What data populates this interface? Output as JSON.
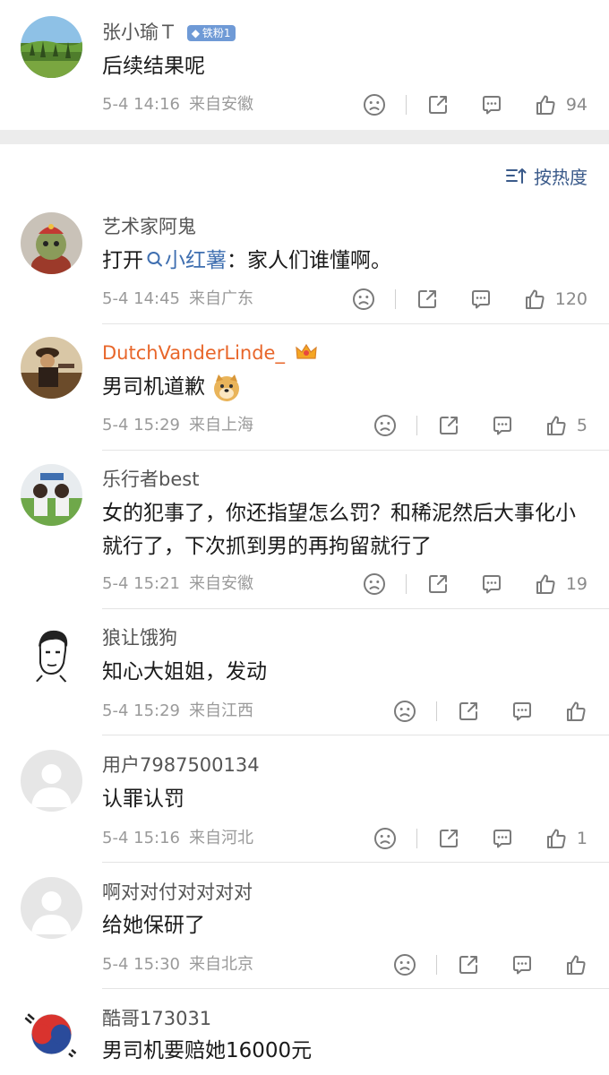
{
  "post": {
    "username": "张小瑜Ｔ",
    "badge": "铁粉1",
    "text": "后续结果呢",
    "date": "5-4 14:16",
    "location": "来自安徽",
    "likes": "94"
  },
  "sort": {
    "label": "按热度"
  },
  "comments": [
    {
      "username": "艺术家阿鬼",
      "text_prefix": "打开",
      "link_text": "小红薯",
      "text_suffix": "：家人们谁懂啊。",
      "date": "5-4 14:45",
      "location": "来自广东",
      "likes": "120"
    },
    {
      "username": "DutchVanderLinde_",
      "text": "男司机道歉",
      "date": "5-4 15:29",
      "location": "来自上海",
      "likes": "5"
    },
    {
      "username": "乐行者best",
      "text": "女的犯事了，你还指望怎么罚？和稀泥然后大事化小就行了，下次抓到男的再拘留就行了",
      "date": "5-4 15:21",
      "location": "来自安徽",
      "likes": "19"
    },
    {
      "username": "狼让饿狗",
      "text": "知心大姐姐，发动",
      "date": "5-4 15:29",
      "location": "来自江西",
      "likes": ""
    },
    {
      "username": "用户7987500134",
      "text": "认罪认罚",
      "date": "5-4 15:16",
      "location": "来自河北",
      "likes": "1"
    },
    {
      "username": "啊对对付对对对对",
      "text": "给她保研了",
      "date": "5-4 15:30",
      "location": "来自北京",
      "likes": ""
    },
    {
      "username": "酷哥173031",
      "text": "男司机要赔她16000元",
      "date": "",
      "location": "",
      "likes": ""
    }
  ],
  "colors": {
    "link": "#3f6fb0",
    "vip_name": "#e8662a",
    "badge": "#6f9ad6",
    "band": "#ececec"
  },
  "icons": [
    "frown-icon",
    "share-icon",
    "comment-icon",
    "thumbs-up-icon",
    "sort-icon",
    "search-icon",
    "crown-icon",
    "doge-emoji"
  ]
}
